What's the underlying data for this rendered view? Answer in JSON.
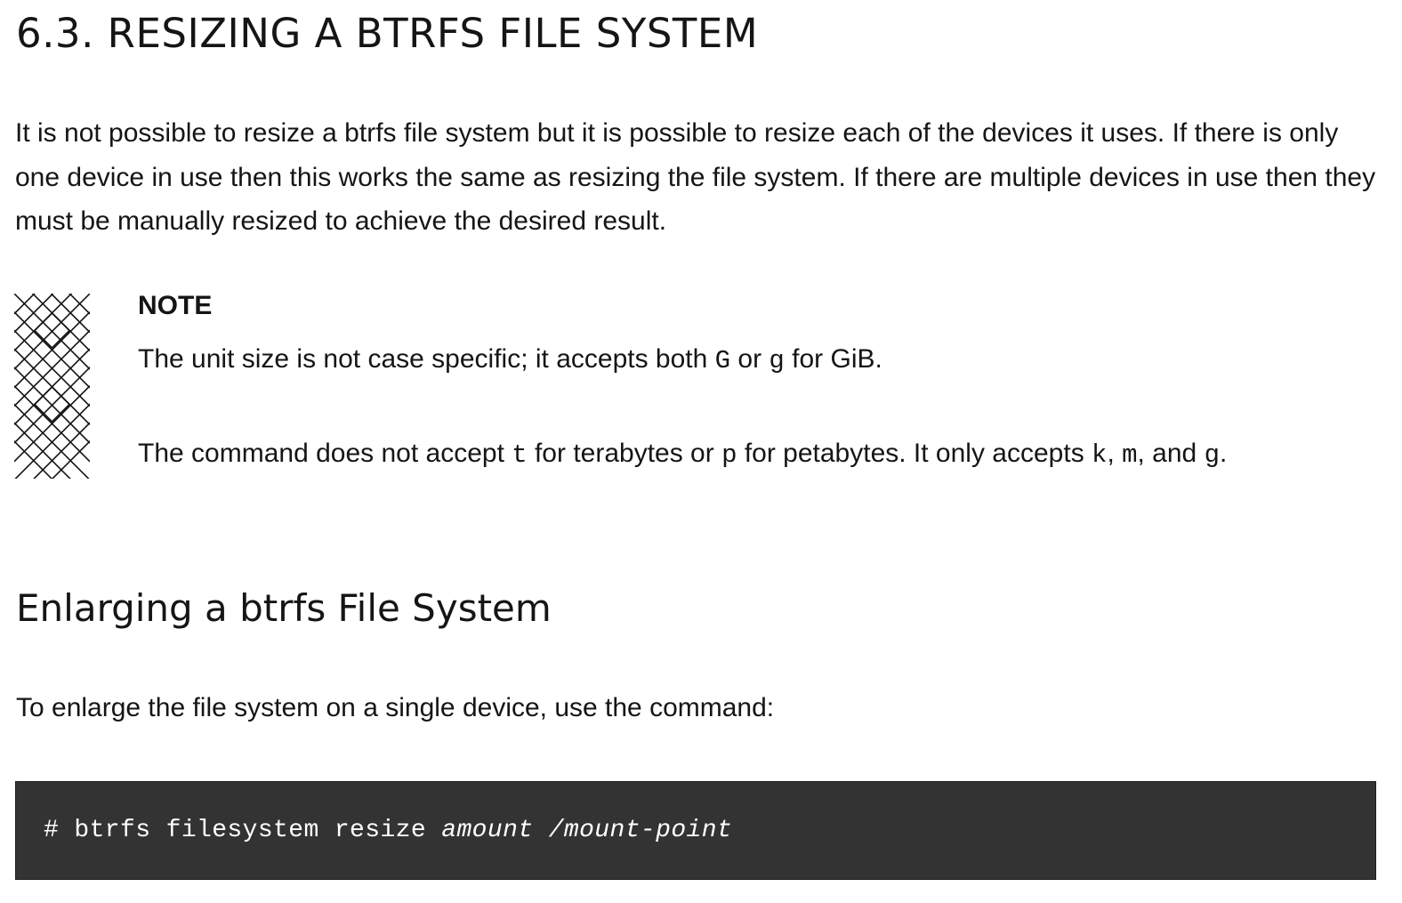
{
  "section": {
    "title": "6.3. RESIZING A BTRFS FILE SYSTEM",
    "intro": "It is not possible to resize a btrfs file system but it is possible to resize each of the devices it uses. If there is only one device in use then this works the same as resizing the file system. If there are multiple devices in use then they must be manually resized to achieve the desired result."
  },
  "note": {
    "icon": "note-pattern-icon",
    "title": "NOTE",
    "p1": {
      "a": "The unit size is not case specific; it accepts both ",
      "code1": "G",
      "b": " or ",
      "code2": "g",
      "c": " for GiB."
    },
    "p2": {
      "a": "The command does not accept ",
      "code1": "t",
      "b": " for terabytes or ",
      "code2": "p",
      "c": " for petabytes. It only accepts ",
      "code3": "k",
      "d": ", ",
      "code4": "m",
      "e": ", and ",
      "code5": "g",
      "f": "."
    }
  },
  "subsection": {
    "title": "Enlarging a btrfs File System",
    "lead": "To enlarge the file system on a single device, use the command:"
  },
  "command": {
    "prefix": "# btrfs filesystem resize ",
    "arg1": "amount",
    "sep": " ",
    "arg2": "/mount-point"
  },
  "colors": {
    "text": "#151515",
    "code_bg": "#333333",
    "code_text": "#ffffff"
  }
}
